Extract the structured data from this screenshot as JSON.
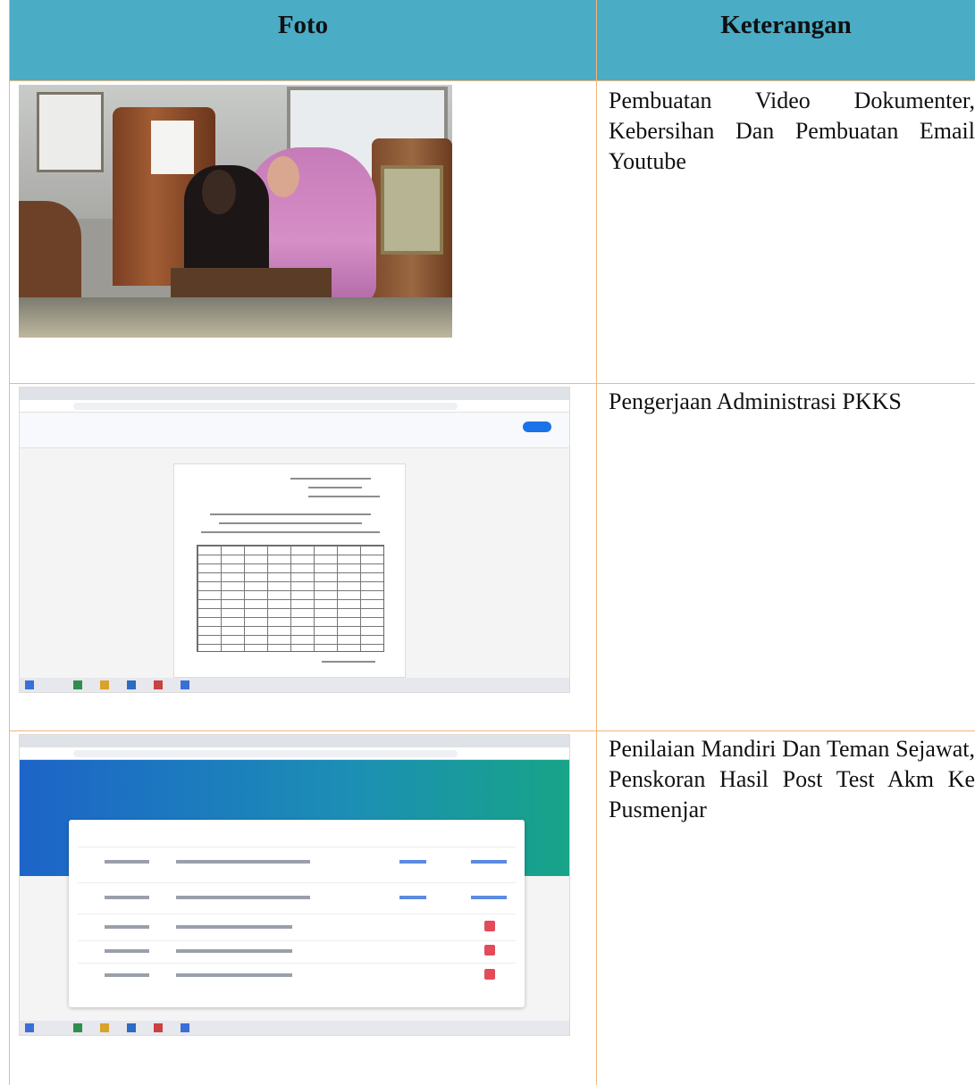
{
  "table": {
    "header": {
      "foto": "Foto",
      "keterangan": "Keterangan"
    },
    "rows": [
      {
        "keterangan": "Pembuatan Video Dokumenter, Kebersihan Dan Pembuatan Email Youtube",
        "photo_icon": "photo-meeting"
      },
      {
        "keterangan": "Pengerjaan Administrasi PKKS",
        "photo_icon": "screenshot-document-editor"
      },
      {
        "keterangan": "Penilaian Mandiri Dan Teman Sejawat, Penskoran Hasil Post Test Akm Ke Pusmenjar",
        "photo_icon": "screenshot-web-portal"
      }
    ]
  },
  "colors": {
    "header_bg": "#4bacc6",
    "border": "#f2b77a"
  }
}
